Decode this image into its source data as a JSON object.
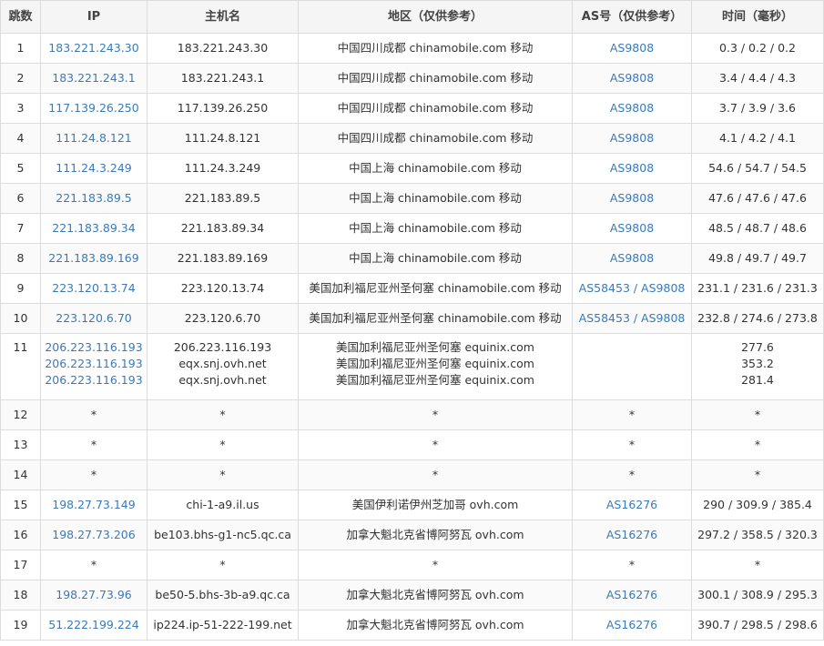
{
  "headers": {
    "hop": "跳数",
    "ip": "IP",
    "host": "主机名",
    "location": "地区（仅供参考）",
    "asn": "AS号（仅供参考）",
    "time": "时间（毫秒）"
  },
  "rows": [
    {
      "hop": "1",
      "ip": [
        "183.221.243.30"
      ],
      "host": [
        "183.221.243.30"
      ],
      "loc": [
        "中国四川成都 chinamobile.com 移动"
      ],
      "as": [
        "AS9808"
      ],
      "time": [
        "0.3 / 0.2 / 0.2"
      ]
    },
    {
      "hop": "2",
      "ip": [
        "183.221.243.1"
      ],
      "host": [
        "183.221.243.1"
      ],
      "loc": [
        "中国四川成都 chinamobile.com 移动"
      ],
      "as": [
        "AS9808"
      ],
      "time": [
        "3.4 / 4.4 / 4.3"
      ]
    },
    {
      "hop": "3",
      "ip": [
        "117.139.26.250"
      ],
      "host": [
        "117.139.26.250"
      ],
      "loc": [
        "中国四川成都 chinamobile.com 移动"
      ],
      "as": [
        "AS9808"
      ],
      "time": [
        "3.7 / 3.9 / 3.6"
      ]
    },
    {
      "hop": "4",
      "ip": [
        "111.24.8.121"
      ],
      "host": [
        "111.24.8.121"
      ],
      "loc": [
        "中国四川成都 chinamobile.com 移动"
      ],
      "as": [
        "AS9808"
      ],
      "time": [
        "4.1 / 4.2 / 4.1"
      ]
    },
    {
      "hop": "5",
      "ip": [
        "111.24.3.249"
      ],
      "host": [
        "111.24.3.249"
      ],
      "loc": [
        "中国上海 chinamobile.com 移动"
      ],
      "as": [
        "AS9808"
      ],
      "time": [
        "54.6 / 54.7 / 54.5"
      ]
    },
    {
      "hop": "6",
      "ip": [
        "221.183.89.5"
      ],
      "host": [
        "221.183.89.5"
      ],
      "loc": [
        "中国上海 chinamobile.com 移动"
      ],
      "as": [
        "AS9808"
      ],
      "time": [
        "47.6 / 47.6 / 47.6"
      ]
    },
    {
      "hop": "7",
      "ip": [
        "221.183.89.34"
      ],
      "host": [
        "221.183.89.34"
      ],
      "loc": [
        "中国上海 chinamobile.com 移动"
      ],
      "as": [
        "AS9808"
      ],
      "time": [
        "48.5 / 48.7 / 48.6"
      ]
    },
    {
      "hop": "8",
      "ip": [
        "221.183.89.169"
      ],
      "host": [
        "221.183.89.169"
      ],
      "loc": [
        "中国上海 chinamobile.com 移动"
      ],
      "as": [
        "AS9808"
      ],
      "time": [
        "49.8 / 49.7 / 49.7"
      ]
    },
    {
      "hop": "9",
      "ip": [
        "223.120.13.74"
      ],
      "host": [
        "223.120.13.74"
      ],
      "loc": [
        "美国加利福尼亚州圣何塞 chinamobile.com 移动"
      ],
      "as": [
        "AS58453 / AS9808"
      ],
      "time": [
        "231.1 / 231.6 / 231.3"
      ]
    },
    {
      "hop": "10",
      "ip": [
        "223.120.6.70"
      ],
      "host": [
        "223.120.6.70"
      ],
      "loc": [
        "美国加利福尼亚州圣何塞 chinamobile.com 移动"
      ],
      "as": [
        "AS58453 / AS9808"
      ],
      "time": [
        "232.8 / 274.6 / 273.8"
      ]
    },
    {
      "hop": "11",
      "ip": [
        "206.223.116.193",
        "206.223.116.193",
        "206.223.116.193"
      ],
      "host": [
        "206.223.116.193",
        "eqx.snj.ovh.net",
        "eqx.snj.ovh.net"
      ],
      "loc": [
        "美国加利福尼亚州圣何塞 equinix.com",
        "美国加利福尼亚州圣何塞 equinix.com",
        "美国加利福尼亚州圣何塞 equinix.com"
      ],
      "as": [],
      "time": [
        "277.6",
        "353.2",
        "281.4"
      ]
    },
    {
      "hop": "12",
      "ip": [
        "*"
      ],
      "host": [
        "*"
      ],
      "loc": [
        "*"
      ],
      "as": [
        "*"
      ],
      "time": [
        "*"
      ]
    },
    {
      "hop": "13",
      "ip": [
        "*"
      ],
      "host": [
        "*"
      ],
      "loc": [
        "*"
      ],
      "as": [
        "*"
      ],
      "time": [
        "*"
      ]
    },
    {
      "hop": "14",
      "ip": [
        "*"
      ],
      "host": [
        "*"
      ],
      "loc": [
        "*"
      ],
      "as": [
        "*"
      ],
      "time": [
        "*"
      ]
    },
    {
      "hop": "15",
      "ip": [
        "198.27.73.149"
      ],
      "host": [
        "chi-1-a9.il.us"
      ],
      "loc": [
        "美国伊利诺伊州芝加哥 ovh.com"
      ],
      "as": [
        "AS16276"
      ],
      "time": [
        "290 / 309.9 / 385.4"
      ]
    },
    {
      "hop": "16",
      "ip": [
        "198.27.73.206"
      ],
      "host": [
        "be103.bhs-g1-nc5.qc.ca"
      ],
      "loc": [
        "加拿大魁北克省博阿努瓦 ovh.com"
      ],
      "as": [
        "AS16276"
      ],
      "time": [
        "297.2 / 358.5 / 320.3"
      ]
    },
    {
      "hop": "17",
      "ip": [
        "*"
      ],
      "host": [
        "*"
      ],
      "loc": [
        "*"
      ],
      "as": [
        "*"
      ],
      "time": [
        "*"
      ]
    },
    {
      "hop": "18",
      "ip": [
        "198.27.73.96"
      ],
      "host": [
        "be50-5.bhs-3b-a9.qc.ca"
      ],
      "loc": [
        "加拿大魁北克省博阿努瓦 ovh.com"
      ],
      "as": [
        "AS16276"
      ],
      "time": [
        "300.1 / 308.9 / 295.3"
      ]
    },
    {
      "hop": "19",
      "ip": [
        "51.222.199.224"
      ],
      "host": [
        "ip224.ip-51-222-199.net"
      ],
      "loc": [
        "加拿大魁北克省博阿努瓦 ovh.com"
      ],
      "as": [
        "AS16276"
      ],
      "time": [
        "390.7 / 298.5 / 298.6"
      ]
    }
  ],
  "colors": {
    "link": "#3a7ab8",
    "border": "#dcdcdc",
    "text": "#333333"
  }
}
